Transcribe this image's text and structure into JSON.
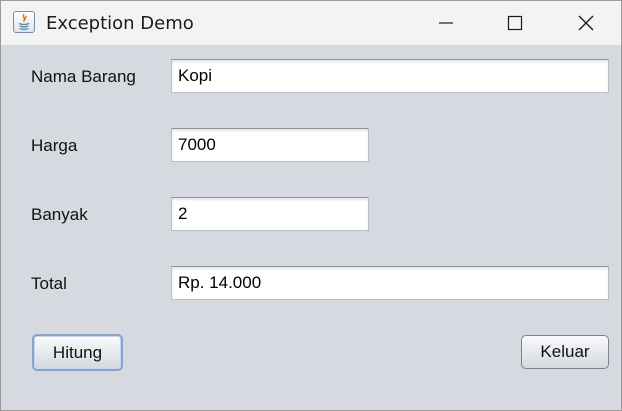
{
  "window": {
    "title": "Exception Demo",
    "app_icon": "java-icon",
    "controls": {
      "minimize_icon": "minimize-icon",
      "maximize_icon": "maximize-icon",
      "close_icon": "close-icon"
    }
  },
  "form": {
    "nama_barang": {
      "label": "Nama Barang",
      "value": "Kopi"
    },
    "harga": {
      "label": "Harga",
      "value": "7000"
    },
    "banyak": {
      "label": "Banyak",
      "value": "2"
    },
    "total": {
      "label": "Total",
      "value": "Rp. 14.000"
    }
  },
  "buttons": {
    "hitung": "Hitung",
    "keluar": "Keluar"
  },
  "colors": {
    "panel_background": "#d6d9df",
    "titlebar_background": "#f3f3f3",
    "java_icon_orange": "#e76f00",
    "java_icon_blue": "#5382a1"
  }
}
